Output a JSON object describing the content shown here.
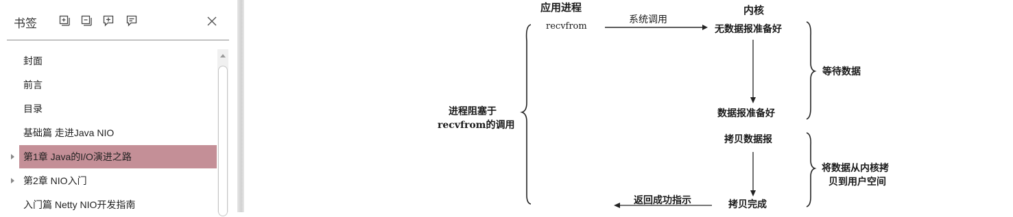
{
  "sidebar": {
    "title": "书签",
    "tool_icons": [
      "expand-all-icon",
      "collapse-all-icon",
      "add-bookmark-icon",
      "bookmark-comment-icon"
    ],
    "close_icon": "close-icon",
    "items": [
      {
        "label": "封面",
        "has_children": false,
        "selected": false
      },
      {
        "label": "前言",
        "has_children": false,
        "selected": false
      },
      {
        "label": "目录",
        "has_children": false,
        "selected": false
      },
      {
        "label": "基础篇 走进Java NIO",
        "has_children": false,
        "selected": false
      },
      {
        "label": "第1章 Java的I/O演进之路",
        "has_children": true,
        "selected": true
      },
      {
        "label": "第2章 NIO入门",
        "has_children": true,
        "selected": false
      },
      {
        "label": "入门篇 Netty NIO开发指南",
        "has_children": false,
        "selected": false
      }
    ],
    "selected_color": "#c48f97"
  },
  "figure": {
    "col_app": "应用进程",
    "col_kernel": "内核",
    "recvfrom": "recvfrom",
    "syscall": "系统调用",
    "no_datagram": "无数据报准备好",
    "wait_data": "等待数据",
    "blocked_line1": "进程阻塞于",
    "blocked_line2": "recvfrom的调用",
    "datagram_ready": "数据报准备好",
    "copy_datagram": "拷贝数据报",
    "copy_line1": "将数据从内核拷",
    "copy_line2": "贝到用户空间",
    "return_success": "返回成功指示",
    "copy_done": "拷贝完成"
  }
}
